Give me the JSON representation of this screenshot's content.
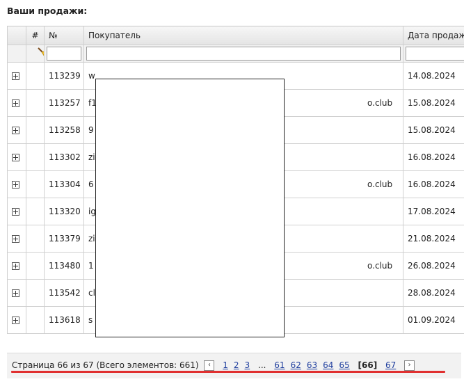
{
  "page": {
    "title": "Ваши продажи:"
  },
  "table": {
    "headers": {
      "hash": "#",
      "num": "№",
      "buyer": "Покупатель",
      "date": "Дата продаж"
    },
    "rows": [
      {
        "id": "113239",
        "buyer": "w",
        "date": "14.08.2024"
      },
      {
        "id": "113257",
        "buyer": "f1",
        "date": "15.08.2024"
      },
      {
        "id": "113258",
        "buyer": "9",
        "date": "15.08.2024"
      },
      {
        "id": "113302",
        "buyer": "zi",
        "date": "16.08.2024"
      },
      {
        "id": "113304",
        "buyer": "6",
        "date": "16.08.2024"
      },
      {
        "id": "113320",
        "buyer": "ig",
        "date": "17.08.2024"
      },
      {
        "id": "113379",
        "buyer": "zi",
        "date": "21.08.2024"
      },
      {
        "id": "113480",
        "buyer": "1",
        "date": "26.08.2024"
      },
      {
        "id": "113542",
        "buyer": "cl",
        "date": "28.08.2024"
      },
      {
        "id": "113618",
        "buyer": "s",
        "date": "01.09.2024"
      }
    ],
    "buyer_tails": [
      {
        "row": 1,
        "text": "o.club"
      },
      {
        "row": 4,
        "text": "o.club"
      },
      {
        "row": 7,
        "text": "o.club"
      }
    ]
  },
  "pager": {
    "summary": "Страница 66 из 67 (Всего элементов: 661)",
    "prev_icon": "chevron-left-icon",
    "next_icon": "chevron-right-icon",
    "pages_first": [
      "1",
      "2",
      "3"
    ],
    "ellipsis": "...",
    "pages_mid": [
      "61",
      "62",
      "63",
      "64",
      "65"
    ],
    "current": "[66]",
    "pages_last": [
      "67"
    ]
  },
  "colors": {
    "link": "#1f3e9e",
    "highlight": "#e03030"
  }
}
